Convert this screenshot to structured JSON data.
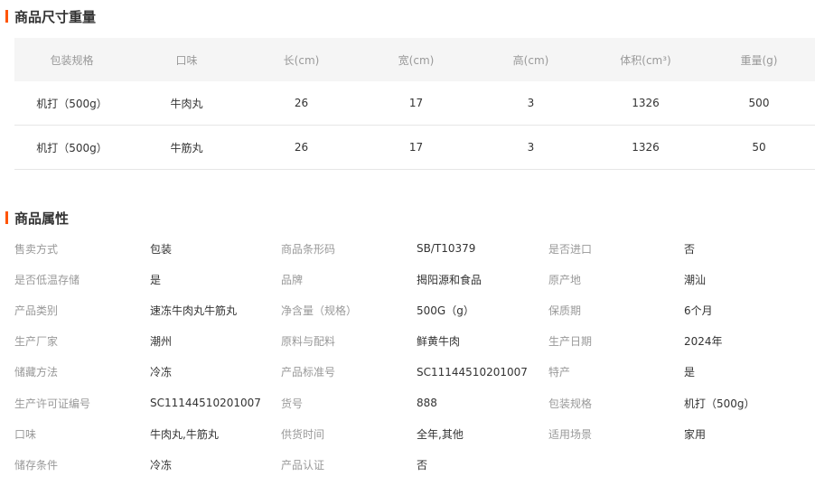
{
  "size_section": {
    "title": "商品尺寸重量",
    "headers": [
      "包装规格",
      "口味",
      "长(cm)",
      "宽(cm)",
      "高(cm)",
      "体积(cm³)",
      "重量(g)"
    ],
    "rows": [
      [
        "机打（500g）",
        "牛肉丸",
        "26",
        "17",
        "3",
        "1326",
        "500"
      ],
      [
        "机打（500g）",
        "牛筋丸",
        "26",
        "17",
        "3",
        "1326",
        "50"
      ]
    ]
  },
  "attr_section": {
    "title": "商品属性",
    "rows": [
      [
        {
          "k": "售卖方式",
          "v": "包装"
        },
        {
          "k": "商品条形码",
          "v": "SB/T10379"
        },
        {
          "k": "是否进口",
          "v": "否"
        }
      ],
      [
        {
          "k": "是否低温存储",
          "v": "是"
        },
        {
          "k": "品牌",
          "v": "揭阳源和食品"
        },
        {
          "k": "原产地",
          "v": "潮汕"
        }
      ],
      [
        {
          "k": "产品类别",
          "v": "速冻牛肉丸牛筋丸"
        },
        {
          "k": "净含量（规格）",
          "v": "500G（g）"
        },
        {
          "k": "保质期",
          "v": "6个月"
        }
      ],
      [
        {
          "k": "生产厂家",
          "v": "潮州"
        },
        {
          "k": "原料与配料",
          "v": "鲜黄牛肉"
        },
        {
          "k": "生产日期",
          "v": "2024年"
        }
      ],
      [
        {
          "k": "储藏方法",
          "v": "冷冻"
        },
        {
          "k": "产品标准号",
          "v": "SC11144510201007"
        },
        {
          "k": "特产",
          "v": "是"
        }
      ],
      [
        {
          "k": "生产许可证编号",
          "v": "SC11144510201007"
        },
        {
          "k": "货号",
          "v": "888"
        },
        {
          "k": "包装规格",
          "v": "机打（500g）"
        }
      ],
      [
        {
          "k": "口味",
          "v": "牛肉丸,牛筋丸"
        },
        {
          "k": "供货时间",
          "v": "全年,其他"
        },
        {
          "k": "适用场景",
          "v": "家用"
        }
      ],
      [
        {
          "k": "储存条件",
          "v": "冷冻"
        },
        {
          "k": "产品认证",
          "v": "否"
        },
        {
          "k": "",
          "v": ""
        }
      ]
    ]
  },
  "colors": {
    "accent": "#ff5400",
    "header_bg": "#f5f5f5",
    "key_text": "#999999",
    "value_text": "#333333"
  }
}
